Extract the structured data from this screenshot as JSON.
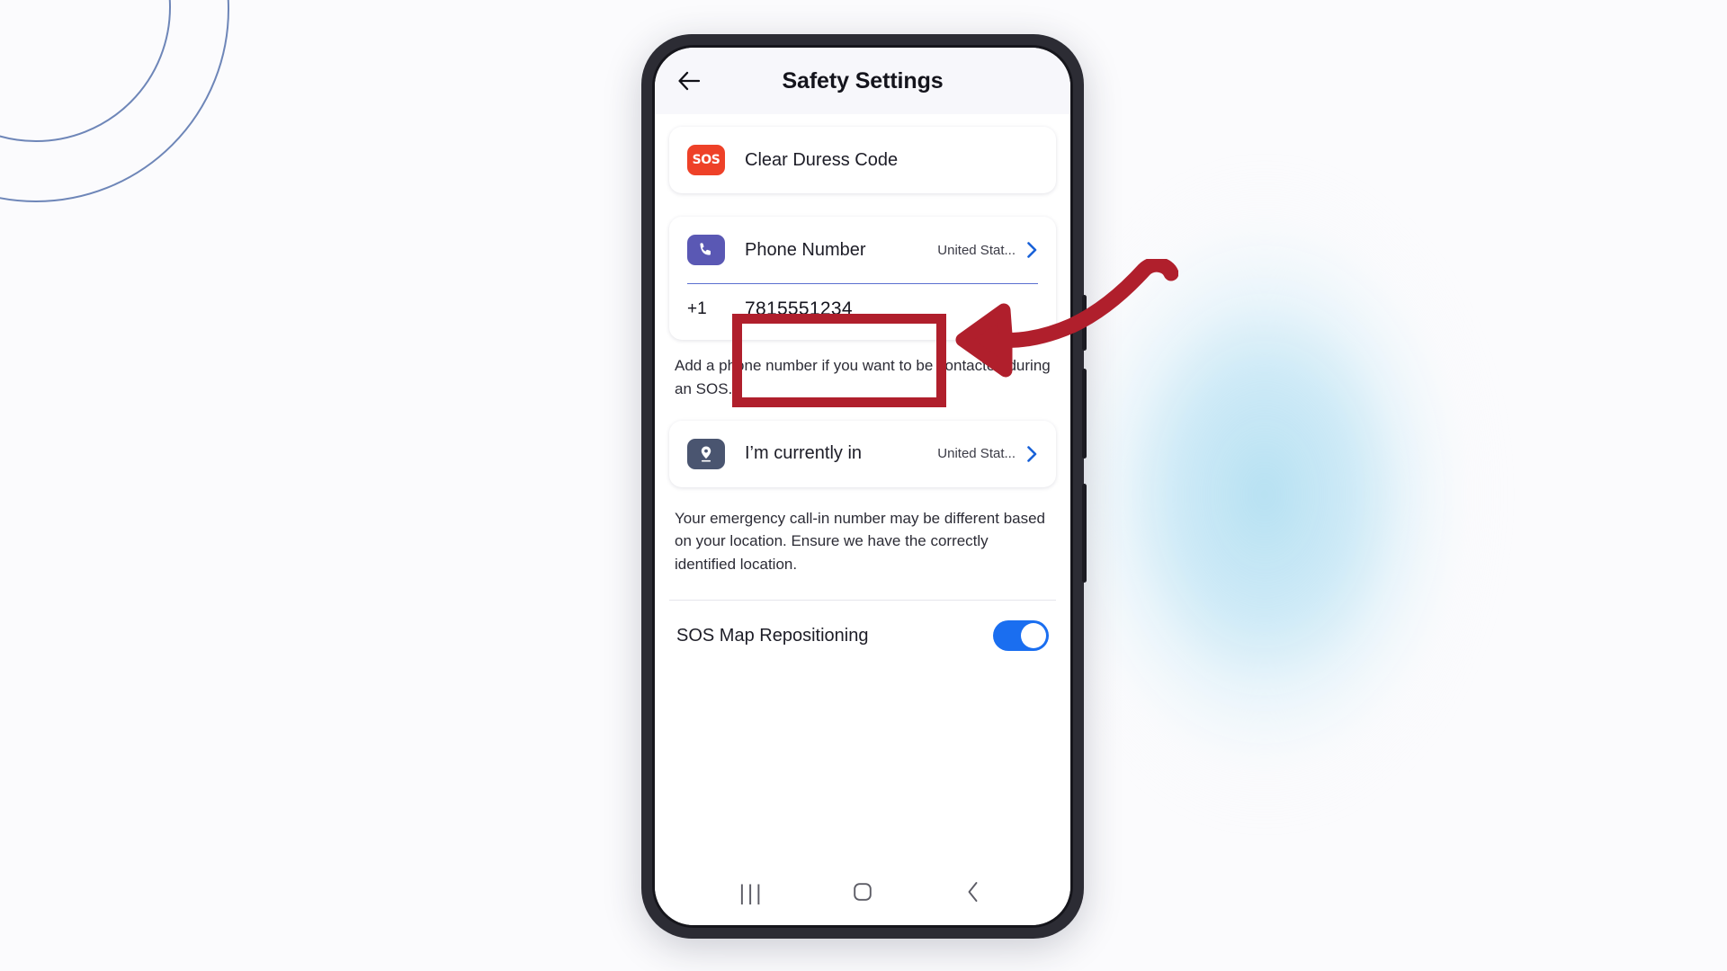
{
  "header": {
    "title": "Safety Settings",
    "back_icon": "arrow-left-icon"
  },
  "duress_card": {
    "icon_label": "SOS",
    "icon_name": "sos-badge-icon",
    "label": "Clear Duress Code"
  },
  "phone_card": {
    "icon_name": "phone-handset-icon",
    "label": "Phone Number",
    "value": "United Stat...",
    "chevron": "›",
    "country_code": "+1",
    "number": "7815551234",
    "helper": "Add a phone number if you want to be contacted during an SOS."
  },
  "location_card": {
    "icon_name": "location-pin-icon",
    "label": "I’m currently in",
    "value": "United Stat...",
    "chevron": "›",
    "helper": "Your emergency call-in number may be different based on your location. Ensure we have the correctly identified location."
  },
  "toggle_row": {
    "label": "SOS Map Repositioning",
    "state": "on"
  },
  "nav_bar": {
    "recents": "|||",
    "home_icon": "home-square-icon",
    "back_icon": "chevron-left-icon"
  },
  "annotations": {
    "highlight_box": "phone-number-field",
    "arrow": "curved-arrow-left",
    "color": "#b01f2c"
  },
  "theme": {
    "sos_red": "#ee4128",
    "phone_purple": "#5a58b4",
    "pin_slate": "#4a5570",
    "toggle_blue": "#1a6ef0",
    "chevron_blue": "#1a62d8",
    "input_underline": "#5a6fd0",
    "page_bg": "#fbfbfd",
    "glow_blue": "#b0def1",
    "ring_stroke": "#6e86b8"
  }
}
